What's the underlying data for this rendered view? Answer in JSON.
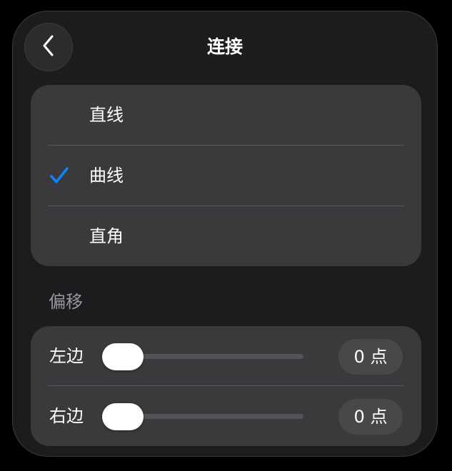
{
  "header": {
    "title": "连接",
    "back_icon": "chevron-left-icon"
  },
  "connection": {
    "options": [
      {
        "label": "直线",
        "selected": false
      },
      {
        "label": "曲线",
        "selected": true
      },
      {
        "label": "直角",
        "selected": false
      }
    ],
    "check_icon": "checkmark-icon",
    "accent_color": "#0a84ff"
  },
  "offset": {
    "section_label": "偏移",
    "sliders": [
      {
        "label": "左边",
        "value_text": "0 点",
        "value": 0
      },
      {
        "label": "右边",
        "value_text": "0 点",
        "value": 0
      }
    ]
  }
}
